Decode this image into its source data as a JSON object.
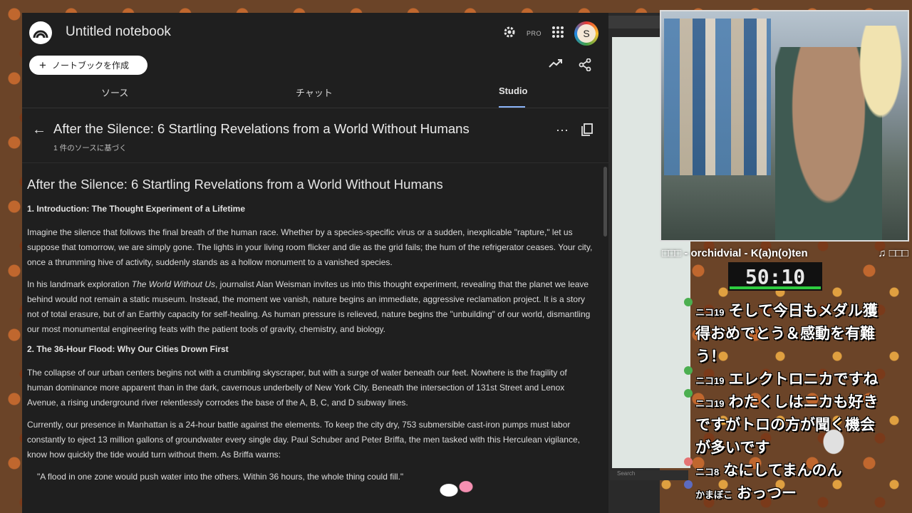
{
  "app": {
    "title": "Untitled notebook",
    "pro_label": "PRO",
    "create_button": "ノートブックを作成",
    "avatar_letter": "S"
  },
  "tabs": [
    {
      "label": "ソース"
    },
    {
      "label": "チャット"
    },
    {
      "label": "Studio",
      "active": true
    }
  ],
  "doc": {
    "title": "After the Silence: 6 Startling Revelations from a World Without Humans",
    "subtitle": "1 件のソースに基づく"
  },
  "content": {
    "heading": "After the Silence: 6 Startling Revelations from a World Without Humans",
    "section1": "1. Introduction: The Thought Experiment of a Lifetime",
    "p1": "Imagine the silence that follows the final breath of the human race. Whether by a species-specific virus or a sudden, inexplicable \"rapture,\" let us suppose that tomorrow, we are simply gone. The lights in your living room flicker and die as the grid fails; the hum of the refrigerator ceases. Your city, once a thrumming hive of activity, suddenly stands as a hollow monument to a vanished species.",
    "p2_before": "In his landmark exploration ",
    "p2_book": "The World Without Us",
    "p2_after": ", journalist Alan Weisman invites us into this thought experiment, revealing that the planet we leave behind would not remain a static museum. Instead, the moment we vanish, nature begins an immediate, aggressive reclamation project. It is a story not of total erasure, but of an Earthly capacity for self-healing. As human pressure is relieved, nature begins the \"unbuilding\" of our world, dismantling our most monumental engineering feats with the patient tools of gravity, chemistry, and biology.",
    "section2": "2. The 36-Hour Flood: Why Our Cities Drown First",
    "p3": "The collapse of our urban centers begins not with a crumbling skyscraper, but with a surge of water beneath our feet. Nowhere is the fragility of human dominance more apparent than in the dark, cavernous underbelly of New York City. Beneath the intersection of 131st Street and Lenox Avenue, a rising underground river relentlessly corrodes the base of the A, B, C, and D subway lines.",
    "p4": "Currently, our presence in Manhattan is a 24-hour battle against the elements. To keep the city dry, 753 submersible cast-iron pumps must labor constantly to eject 13 million gallons of groundwater every single day. Paul Schuber and Peter Briffa, the men tasked with this Herculean vigilance, know how quickly the tide would turn without them. As Briffa warns:",
    "quote": "\"A flood in one zone would push water into the others. Within 36 hours, the whole thing could fill.\""
  },
  "overlay": {
    "music_left": "□□□ - orchidvial - K(a)n(o)ten",
    "music_right": "♫ □□□",
    "timer": "50:10",
    "side_search": "Search",
    "chat": [
      {
        "user": "ニコ19",
        "msg": "そして今日もメダル獲"
      },
      {
        "user": "",
        "msg": "得おめでとう＆感動を有難"
      },
      {
        "user": "",
        "msg": "う！"
      },
      {
        "user": "ニコ19",
        "msg": "エレクトロニカですね"
      },
      {
        "user": "ニコ19",
        "msg": "わたくしはニカも好き"
      },
      {
        "user": "",
        "msg": "ですがトロの方が聞く機会"
      },
      {
        "user": "",
        "msg": "が多いです"
      },
      {
        "user": "ニコ8",
        "msg": "なにしてまんのん"
      },
      {
        "user": "かまぼこ",
        "msg": "おっつー"
      }
    ]
  },
  "colors": {
    "app_bg": "#1f1f1f",
    "accent": "#8ab4f8",
    "timer_bar": "#2ecc40"
  }
}
